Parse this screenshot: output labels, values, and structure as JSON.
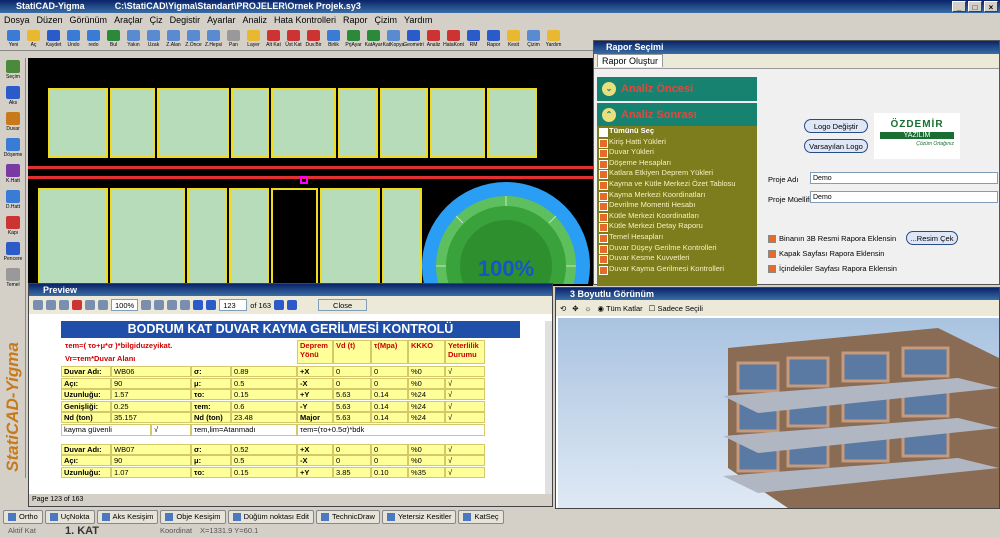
{
  "app": {
    "title": "StatiCAD-Yigma",
    "path": "C:\\StatiCAD\\Yigma\\Standart\\PROJELER\\Ornek Projek.sy3"
  },
  "menu": [
    "Dosya",
    "Düzen",
    "Görünüm",
    "Araçlar",
    "Çiz",
    "Degistir",
    "Ayarlar",
    "Analiz",
    "Hata Kontrolleri",
    "Rapor",
    "Çizim",
    "Yardım"
  ],
  "toolbar": [
    "Yeni",
    "Aç",
    "Kaydet",
    "Undo",
    "redo",
    "Bul",
    "Yakın",
    "Uzak",
    "Z.Alan",
    "Z.Önce",
    "Z.Hepsi",
    "Pan",
    "Layer",
    "Alt Kat",
    "Üst Kat",
    "Duv.Bir",
    "Birlik",
    "PrjAyar",
    "KatAyar",
    "KatKopya",
    "Geometri",
    "Analiz",
    "HataKont",
    "RM",
    "Rapor",
    "Kesit",
    "Çizim",
    "Yardım"
  ],
  "left_tools": [
    "Seçim",
    "Aks",
    "Duvar",
    "Döşeme",
    "K.Hatt",
    "D.Hatt",
    "Kapı",
    "Pencere",
    "Temel"
  ],
  "brand_vertical": "StatiCAD-Yigma",
  "progress": {
    "label": "100%",
    "value": 1.0
  },
  "report_panel": {
    "title": "Rapor Seçimi",
    "tab": "Rapor Oluştur",
    "section1": "Analiz Öncesi",
    "section2": "Analiz Sonrası",
    "items": [
      "Tümünü Seç",
      "Kiriş Hatti Yükleri",
      "Duvar Yükleri",
      "Döşeme Hesapları",
      "Katlara Etkiyen Deprem Yükleri",
      "Kayma ve Kütle Merkezi Özet Tablosu",
      "Kayma Merkezi Koordinatları",
      "Devrilme Momenti Hesabı",
      "Kütle Merkezi Koordinatları",
      "Kütle Merkezi Detay Raporu",
      "Temel Hesapları",
      "Duvar Düşey Gerilme Kontrolleri",
      "Duvar Kesme Kuvvetleri",
      "Duvar Kayma Gerilmesi Kontrolleri"
    ],
    "logo_button": "Logo Değiştir",
    "default_logo_button": "Varsayılan Logo",
    "logo_text": "ÖZDEMİR",
    "logo_sub": "YAZILIM",
    "logo_sub2": "Çözüm Ortağınız",
    "proje_adi_label": "Proje Adı",
    "proje_adi": "Demo",
    "proje_muellifi_label": "Proje Müellifi",
    "proje_muellifi": "Demo",
    "opt1": "Binanın 3B Resmi Rapora  Eklensin",
    "opt2": "Kapak Sayfası Rapora Eklensin",
    "opt3": "İçindekiler Sayfası Rapora Eklensin",
    "resim_button": "...Resim Çek"
  },
  "preview": {
    "title": "Preview",
    "zoom": "100%",
    "page": "123",
    "of": "of 163",
    "close": "Close",
    "footer": "Page 123 of 163",
    "header": "BODRUM KAT DUVAR KAYMA GERİLMESİ KONTROLÜ",
    "formula1": "τem=(  τo+μ*σ  )*bilgiduzeyikat.",
    "formula2": "Vr=τem*Duvar Alanı",
    "col_dir": "Deprem Yönü",
    "col_vd": "Vd (t)",
    "col_t": "τ(Mpa)",
    "col_kk": "KKKO",
    "col_y": "Yeterlilik Durumu",
    "blocks": [
      {
        "labels": [
          "Duvar Adı:",
          "Açı:",
          "Uzunluğu:",
          "Genişliği:",
          "Nd (ton)"
        ],
        "values": [
          "WB06",
          "90",
          "1.57",
          "0.25",
          "35.157"
        ],
        "syms": [
          "σ:",
          "μ:",
          "τo:",
          "τem:",
          "Nd (ton)"
        ],
        "svals": [
          "0.89",
          "0.5",
          "0.15",
          "0.6",
          "23.48"
        ],
        "rows": [
          [
            "+X",
            "0",
            "0",
            "%0",
            "√"
          ],
          [
            "-X",
            "0",
            "0",
            "%0",
            "√"
          ],
          [
            "+Y",
            "5.63",
            "0.14",
            "%24",
            "√"
          ],
          [
            "-Y",
            "5.63",
            "0.14",
            "%24",
            "√"
          ],
          [
            "Major",
            "5.63",
            "0.14",
            "%24",
            "√"
          ]
        ],
        "f1": "kayma güvenli",
        "f1v": "√",
        "f2": "τem,lim=Atanmadı",
        "f3": "τem=(τo+0.5σ)*bdk"
      },
      {
        "labels": [
          "Duvar Adı:",
          "Açı:",
          "Uzunluğu:"
        ],
        "values": [
          "WB07",
          "90",
          "1.07"
        ],
        "syms": [
          "σ:",
          "μ:",
          "τo:"
        ],
        "svals": [
          "0.52",
          "0.5",
          "0.15"
        ],
        "rows": [
          [
            "+X",
            "0",
            "0",
            "%0",
            "√"
          ],
          [
            "-X",
            "0",
            "0",
            "%0",
            "√"
          ],
          [
            "+Y",
            "3.85",
            "0.10",
            "%35",
            "√"
          ]
        ]
      }
    ]
  },
  "view3d": {
    "title": "3 Boyutlu Görünüm",
    "all_floors": "Tüm Katlar",
    "selected_only": "Sadece Seçili"
  },
  "status": [
    "Ortho",
    "UçNokta",
    "Aks Kesişim",
    "Obje Kesişim",
    "Düğüm noktası Edit",
    "TechnicDraw",
    "Yetersiz Kesitler",
    "KatSeç"
  ],
  "bottom": {
    "label": "Aktif Kat",
    "floor": "1. KAT",
    "coord_label": "Koordinat",
    "coord": "X=1331.9   Y=60.1"
  },
  "colors": {
    "title": "#0a246a",
    "accent": "#17826f",
    "report_bg": "#7d7d1e",
    "header_blue": "#1f4fa8",
    "cell_yellow": "#ffff99",
    "gauge": "#2a9df4"
  }
}
